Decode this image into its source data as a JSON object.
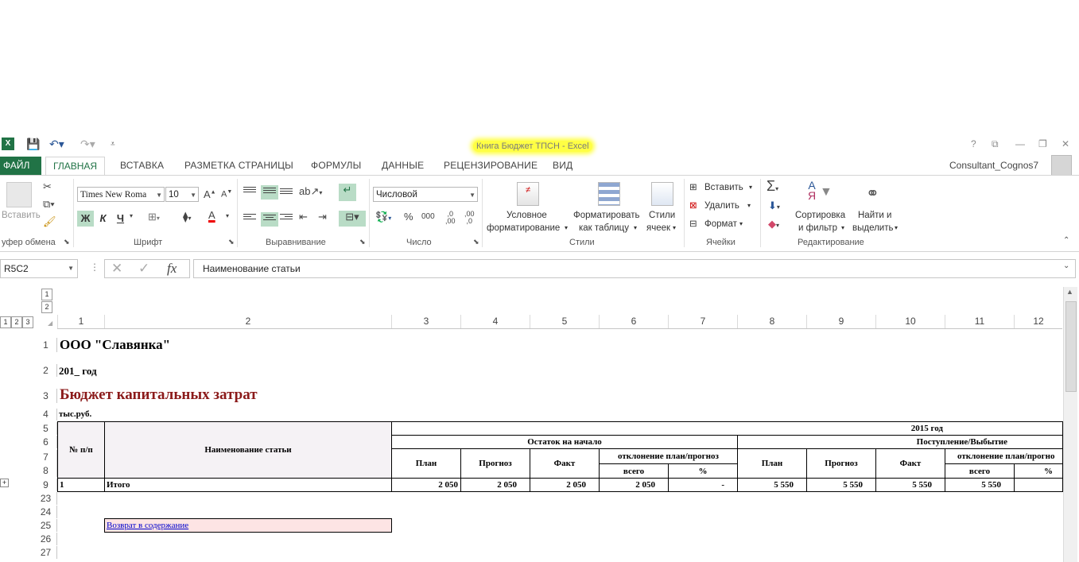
{
  "window": {
    "title": "Книга Бюджет ТПСН - Excel",
    "user": "Consultant_Cognos7",
    "controls": [
      "?",
      "⧉",
      "—",
      "❐",
      "✕"
    ]
  },
  "tabs": {
    "file": "ФАЙЛ",
    "home": "ГЛАВНАЯ",
    "items": [
      "ВСТАВКА",
      "РАЗМЕТКА СТРАНИЦЫ",
      "ФОРМУЛЫ",
      "ДАННЫЕ",
      "РЕЦЕНЗИРОВАНИЕ",
      "ВИД"
    ]
  },
  "ribbon": {
    "clipboard": {
      "label": "уфер обмена",
      "paste": "Вставить"
    },
    "font": {
      "label": "Шрифт",
      "name": "Times New Roma",
      "size": "10",
      "bold": "Ж",
      "italic": "К",
      "underline": "Ч",
      "color_a": "A"
    },
    "alignment": {
      "label": "Выравнивание"
    },
    "number": {
      "label": "Число",
      "format": "Числовой",
      "percent": "%",
      "thousands": "000",
      "dec_inc": ",0\n,00",
      "dec_dec": ",00\n,0"
    },
    "styles": {
      "label": "Стили",
      "conditional": "Условное",
      "conditional2": "форматирование",
      "as_table": "Форматировать",
      "as_table2": "как таблицу",
      "cell_styles": "Стили",
      "cell_styles2": "ячеек"
    },
    "cells": {
      "label": "Ячейки",
      "insert": "Вставить",
      "delete": "Удалить",
      "format": "Формат"
    },
    "editing": {
      "label": "Редактирование",
      "sort": "Сортировка",
      "sort2": "и фильтр",
      "find": "Найти и",
      "find2": "выделить"
    }
  },
  "formula_bar": {
    "name_box": "R5C2",
    "fx": "fx",
    "content": "Наименование статьи"
  },
  "outline": {
    "col_levels": [
      "1",
      "2",
      "3"
    ],
    "row_levels": [
      "1",
      "2"
    ]
  },
  "columns": [
    "1",
    "2",
    "3",
    "4",
    "5",
    "6",
    "7",
    "8",
    "9",
    "10",
    "11",
    "12"
  ],
  "rows": [
    "1",
    "2",
    "3",
    "4",
    "5",
    "6",
    "7",
    "8",
    "9",
    "23",
    "24",
    "25",
    "26",
    "27"
  ],
  "sheet": {
    "company": "ООО \"Славянка\"",
    "year": "201_ год",
    "title": "Бюджет капитальных затрат",
    "units": "тыс.руб.",
    "hdr_num": "№ п/п",
    "hdr_name": "Наименование статьи",
    "hdr_year": "2015 год",
    "hdr_opening": "Остаток на начало",
    "hdr_flow": "Поступление/Выбытие",
    "hdr_plan": "План",
    "hdr_forecast": "Прогноз",
    "hdr_fact": "Факт",
    "hdr_dev": "отклонение план/прогноз",
    "hdr_dev_cut": "отклонение план/прогнo",
    "hdr_total": "всего",
    "hdr_pct": "%",
    "row_num": "1",
    "row_name": "Итого",
    "values_opening": [
      "2 050",
      "2 050",
      "2 050",
      "2 050",
      "-"
    ],
    "values_flow": [
      "5 550",
      "5 550",
      "5 550",
      "5 550"
    ],
    "link": "Возврат в содержание"
  }
}
